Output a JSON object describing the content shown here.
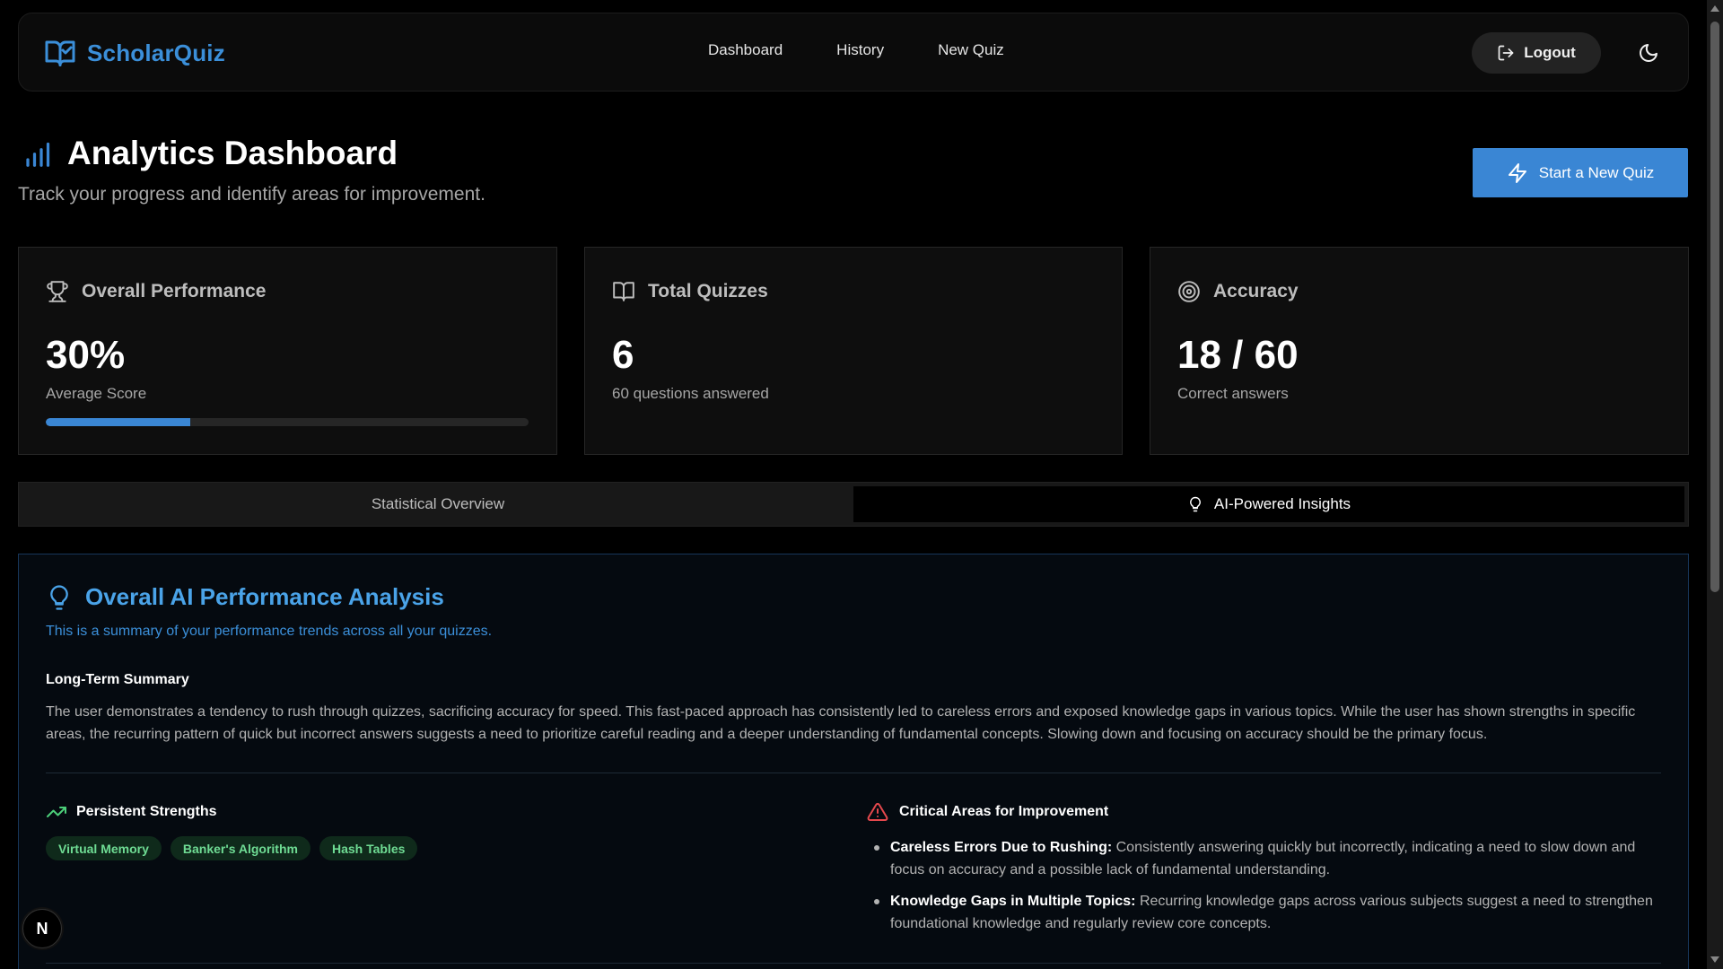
{
  "navbar": {
    "brand": "ScholarQuiz",
    "brand_icon": "book-check-icon",
    "links": [
      "Dashboard",
      "History",
      "New Quiz"
    ],
    "logout_label": "Logout",
    "theme_icon": "moon-icon"
  },
  "header": {
    "title": "Analytics Dashboard",
    "subtitle": "Track your progress and identify areas for improvement.",
    "start_button": "Start a New Quiz",
    "icon": "bar-chart-icon"
  },
  "stats": {
    "performance": {
      "label": "Overall Performance",
      "value": "30%",
      "sub": "Average Score",
      "progress": 0.3,
      "icon": "trophy-icon"
    },
    "quizzes": {
      "label": "Total Quizzes",
      "value": "6",
      "sub": "60 questions answered",
      "icon": "book-open-icon"
    },
    "accuracy": {
      "label": "Accuracy",
      "value": "18 / 60",
      "sub": "Correct answers",
      "icon": "target-icon"
    }
  },
  "tabs": [
    {
      "label": "Statistical Overview",
      "active": false
    },
    {
      "label": "AI-Powered Insights",
      "active": true
    }
  ],
  "ai": {
    "title": "Overall AI Performance Analysis",
    "description": "This is a summary of your performance trends across all your quizzes.",
    "summary_heading": "Long-Term Summary",
    "summary_body": "The user demonstrates a tendency to rush through quizzes, sacrificing accuracy for speed. This fast-paced approach has consistently led to careless errors and exposed knowledge gaps in various topics. While the user has shown strengths in specific areas, the recurring pattern of quick but incorrect answers suggests a need to prioritize careful reading and a deeper understanding of fundamental concepts. Slowing down and focusing on accuracy should be the primary focus.",
    "strengths_heading": "Persistent Strengths",
    "strengths": [
      "Virtual Memory",
      "Banker's Algorithm",
      "Hash Tables"
    ],
    "improve_heading": "Critical Areas for Improvement",
    "improvements": [
      {
        "title": "Careless Errors Due to Rushing:",
        "text": " Consistently answering quickly but incorrectly, indicating a need to slow down and focus on accuracy and a possible lack of fundamental understanding."
      },
      {
        "title": "Knowledge Gaps in Multiple Topics:",
        "text": " Recurring knowledge gaps across various subjects suggest a need to strengthen foundational knowledge and regularly review core concepts."
      }
    ]
  },
  "floating_badge": "N",
  "colors": {
    "accent": "#3a86d4",
    "success": "#6fdc94",
    "danger": "#e5484d",
    "bg": "#000000"
  }
}
